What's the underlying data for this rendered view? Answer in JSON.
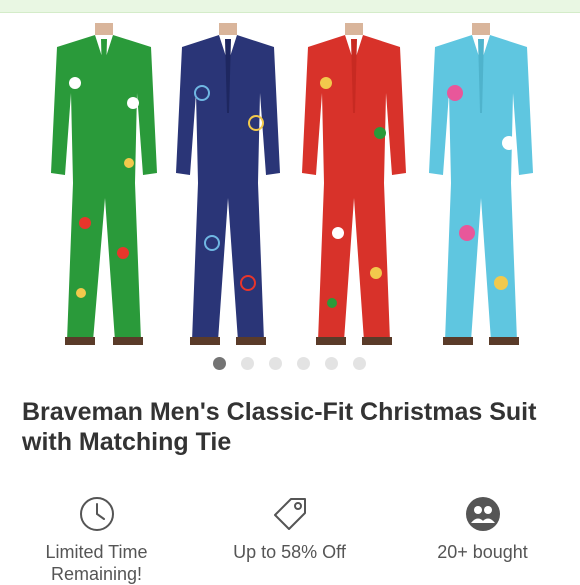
{
  "product": {
    "title": "Braveman Men's Classic-Fit Christmas Suit with Matching Tie"
  },
  "gallery": {
    "suits": [
      {
        "icon": "green-christmas-suit",
        "color": "#2a9a3a",
        "accent": "#e8352b"
      },
      {
        "icon": "navy-christmas-suit",
        "color": "#2a3577",
        "accent": "#6fb7e3"
      },
      {
        "icon": "red-christmas-suit",
        "color": "#d8322a",
        "accent": "#f2c94c"
      },
      {
        "icon": "light-blue-flamingo-suit",
        "color": "#5fc6e0",
        "accent": "#e8579a"
      }
    ],
    "dot_count": 6,
    "active_index": 0
  },
  "features": [
    {
      "icon": "clock-icon",
      "label": "Limited Time Remaining!"
    },
    {
      "icon": "tag-icon",
      "label": "Up to 58% Off"
    },
    {
      "icon": "group-icon",
      "label": "20+ bought"
    }
  ],
  "colors": {
    "topbar": "#e9f7e3",
    "title": "#333333",
    "feature_text": "#555555",
    "icon": "#555555"
  }
}
